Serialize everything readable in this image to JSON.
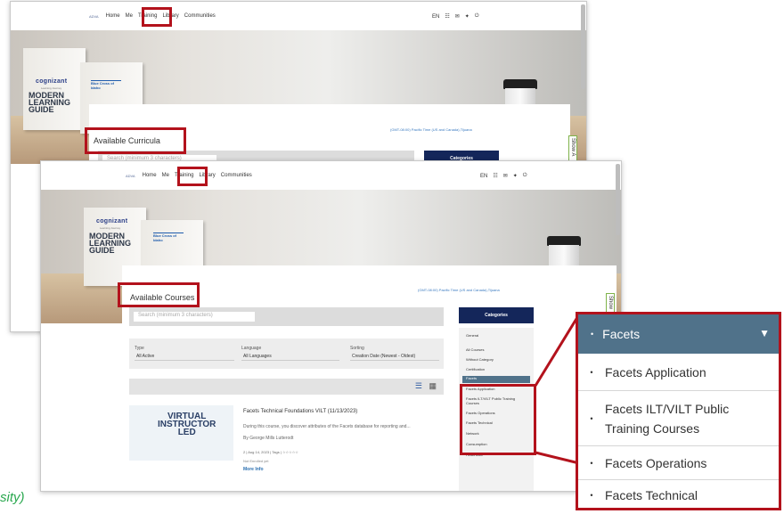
{
  "nav": {
    "logo": "ADVA",
    "items": [
      "Home",
      "Me",
      "Training",
      "Library",
      "Communities"
    ],
    "lang": "EN"
  },
  "hero": {
    "brand": "cognizant",
    "subtitle": "Learning Journey",
    "book_title": "MODERN LEARNING GUIDE",
    "partner": "Blue Cross of Idaho",
    "cup_brand": "cognizant"
  },
  "win1": {
    "title": "Available Curricula",
    "timezone": "(GMT-08:00) Pacific Time (US and Canada),Tijuana",
    "search_placeholder": "Search (minimum 3 characters)",
    "categories": "Categories",
    "show_tab": "Show A"
  },
  "win2": {
    "title": "Available Courses",
    "timezone": "(GMT-08:00) Pacific Time (US and Canada),Tijuana",
    "search_placeholder": "Search (minimum 3 characters)",
    "categories": "Categories",
    "show_tab": "Show",
    "filters": {
      "type_label": "Type",
      "type_value": "All Active",
      "lang_label": "Language",
      "lang_value": "All Languages",
      "sort_label": "Sorting",
      "sort_value": "Creation Date (Newest - Oldest)"
    },
    "course": {
      "thumb_line1": "VIRTUAL",
      "thumb_line2": "INSTRUCTOR",
      "thumb_line3": "LED",
      "title": "Facets Technical Foundations VILT (11/13/2023)",
      "desc": "During this course, you discover attributes of the Facets database for reporting and...",
      "author": "By George Mills Lutterodt",
      "meta": "2  |  Aug 14, 2023  |  Tags  |  ☆☆☆☆☆",
      "status": "Not Enrolled yet",
      "more": "More Info"
    },
    "side": {
      "general": "General",
      "all": "All Courses",
      "without": "Without Category",
      "cert": "Certification",
      "facets": "Facets",
      "sub": [
        "Facets Application",
        "Facets ILT/VILT Public Training Courses",
        "Facets Operations",
        "Facets Technical"
      ],
      "after": [
        "Network",
        "Consumption",
        "Healthcare"
      ]
    }
  },
  "zoom": {
    "header": "Facets",
    "items": [
      "Facets Application",
      "Facets ILT/VILT Public Training Courses",
      "Facets Operations",
      "Facets Technical"
    ]
  },
  "caption_fragment": "sity)"
}
